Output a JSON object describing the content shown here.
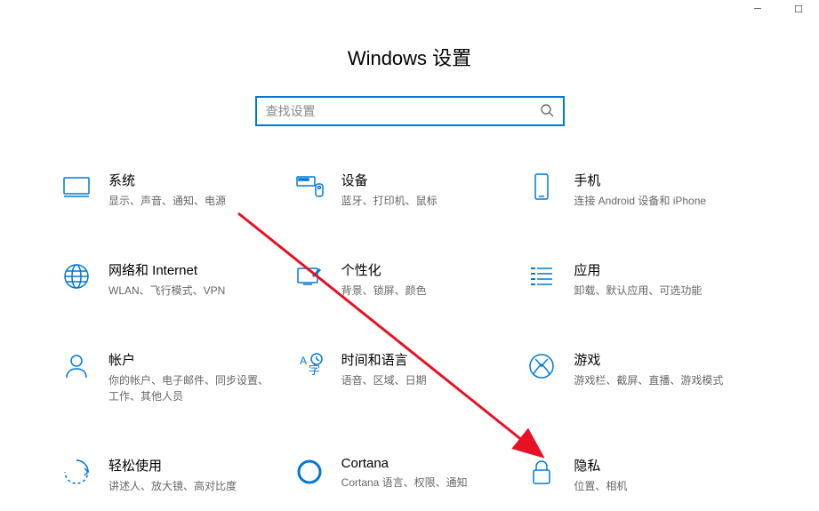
{
  "title": "Windows 设置",
  "search": {
    "placeholder": "查找设置"
  },
  "tiles": [
    {
      "title": "系统",
      "desc": "显示、声音、通知、电源"
    },
    {
      "title": "设备",
      "desc": "蓝牙、打印机、鼠标"
    },
    {
      "title": "手机",
      "desc": "连接 Android 设备和 iPhone"
    },
    {
      "title": "网络和 Internet",
      "desc": "WLAN、飞行模式、VPN"
    },
    {
      "title": "个性化",
      "desc": "背景、锁屏、颜色"
    },
    {
      "title": "应用",
      "desc": "卸载、默认应用、可选功能"
    },
    {
      "title": "帐户",
      "desc": "你的帐户、电子邮件、同步设置、工作、其他人员"
    },
    {
      "title": "时间和语言",
      "desc": "语音、区域、日期"
    },
    {
      "title": "游戏",
      "desc": "游戏栏、截屏、直播、游戏模式"
    },
    {
      "title": "轻松使用",
      "desc": "讲述人、放大镜、高对比度"
    },
    {
      "title": "Cortana",
      "desc": "Cortana 语言、权限、通知"
    },
    {
      "title": "隐私",
      "desc": "位置、相机"
    }
  ]
}
